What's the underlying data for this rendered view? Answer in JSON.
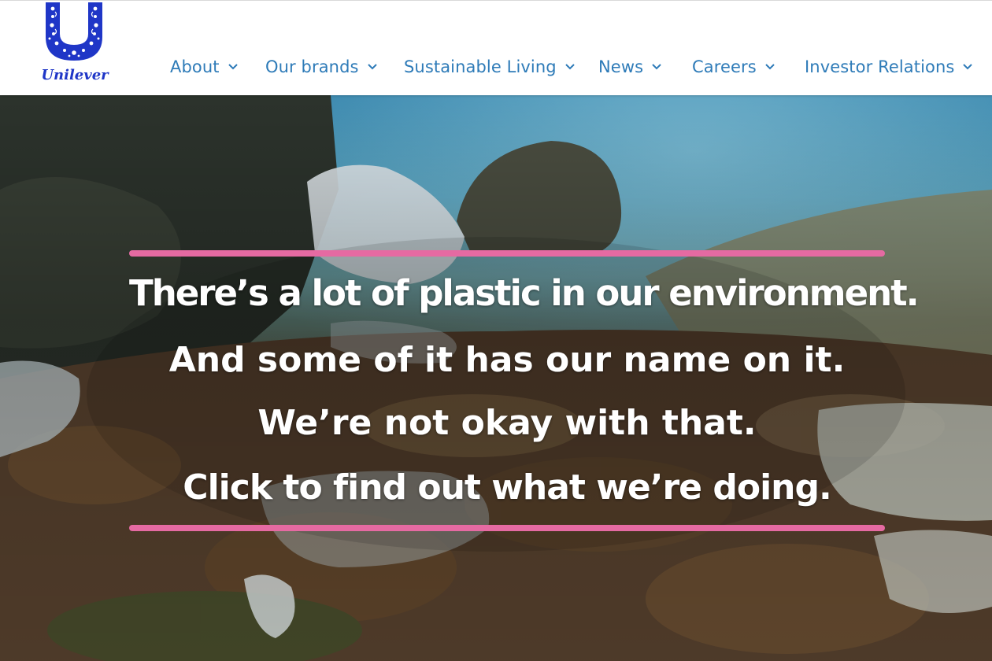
{
  "brand": {
    "name": "Unilever",
    "logo_color": "#1f36c7",
    "logo_icon": "unilever-u-logo-icon"
  },
  "nav": {
    "color": "#2e7bb8",
    "items": [
      {
        "label": "About",
        "icon": "chevron-down-icon"
      },
      {
        "label": "Our brands",
        "icon": "chevron-down-icon"
      },
      {
        "label": "Sustainable Living",
        "icon": "chevron-down-icon"
      },
      {
        "label": "News",
        "icon": "chevron-down-icon"
      },
      {
        "label": "Careers",
        "icon": "chevron-down-icon"
      },
      {
        "label": "Investor Relations",
        "icon": "chevron-down-icon"
      }
    ]
  },
  "hero": {
    "accent_color": "#e56aa2",
    "lines": [
      "There’s a lot of plastic in our environment.",
      "And some of it has our name on it.",
      "We’re not okay with that.",
      "Click to find out what we’re doing."
    ]
  }
}
